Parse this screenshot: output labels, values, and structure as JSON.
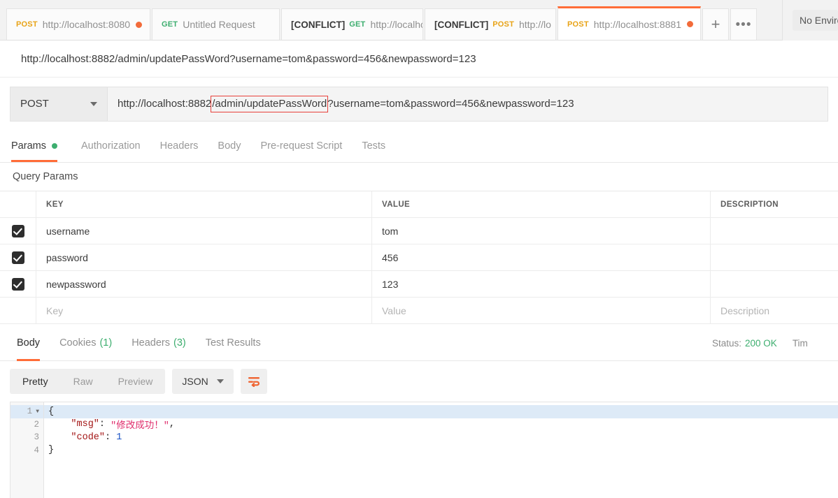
{
  "tabbar": {
    "tabs": [
      {
        "method": "POST",
        "method_color": "#e8a317",
        "label": "http://localhost:8080",
        "conflict": "",
        "unsaved": true,
        "active": false
      },
      {
        "method": "GET",
        "method_color": "#3dae6f",
        "label": "Untitled Request",
        "conflict": "",
        "unsaved": false,
        "active": false
      },
      {
        "method": "GET",
        "method_color": "#3dae6f",
        "label": "http://localho",
        "conflict": "[CONFLICT]",
        "unsaved": false,
        "active": false
      },
      {
        "method": "POST",
        "method_color": "#e8a317",
        "label": "http://lo",
        "conflict": "[CONFLICT]",
        "unsaved": true,
        "active": false
      },
      {
        "method": "POST",
        "method_color": "#e8a317",
        "label": "http://localhost:8881",
        "conflict": "",
        "unsaved": true,
        "active": true
      }
    ],
    "new_tab_label": "+",
    "more_label": "•••",
    "environment_label": "No Environment"
  },
  "request": {
    "title": "http://localhost:8882/admin/updatePassWord?username=tom&password=456&newpassword=123",
    "method": "POST",
    "url_prefix": "http://localhost:8882",
    "url_highlighted": "/admin/updatePassWord",
    "url_suffix": "?username=tom&password=456&newpassword=123",
    "highlight_color": "#e8403a",
    "tabs": [
      {
        "label": "Params",
        "active": true,
        "indicator": true
      },
      {
        "label": "Authorization",
        "active": false,
        "indicator": false
      },
      {
        "label": "Headers",
        "active": false,
        "indicator": false
      },
      {
        "label": "Body",
        "active": false,
        "indicator": false
      },
      {
        "label": "Pre-request Script",
        "active": false,
        "indicator": false
      },
      {
        "label": "Tests",
        "active": false,
        "indicator": false
      }
    ]
  },
  "query_params": {
    "section_title": "Query Params",
    "headers": {
      "key": "KEY",
      "value": "VALUE",
      "description": "DESCRIPTION"
    },
    "rows": [
      {
        "checked": true,
        "key": "username",
        "value": "tom",
        "description": ""
      },
      {
        "checked": true,
        "key": "password",
        "value": "456",
        "description": ""
      },
      {
        "checked": true,
        "key": "newpassword",
        "value": "123",
        "description": ""
      }
    ],
    "placeholder_row": {
      "key": "Key",
      "value": "Value",
      "description": "Description"
    }
  },
  "response": {
    "tabs": [
      {
        "label": "Body",
        "count": "",
        "active": true
      },
      {
        "label": "Cookies",
        "count": "(1)",
        "active": false
      },
      {
        "label": "Headers",
        "count": "(3)",
        "active": false
      },
      {
        "label": "Test Results",
        "count": "",
        "active": false
      }
    ],
    "status_label": "Status:",
    "status_value": "200 OK",
    "status_color": "#3dae6f",
    "time_label": "Tim",
    "view_modes": [
      {
        "label": "Pretty",
        "active": true
      },
      {
        "label": "Raw",
        "active": false
      },
      {
        "label": "Preview",
        "active": false
      }
    ],
    "format": "JSON",
    "wrap_icon": "word-wrap-icon",
    "body_lines": [
      {
        "num": "1",
        "foldable": true,
        "highlighted": true,
        "tokens": [
          {
            "t": "brace",
            "v": "{"
          }
        ]
      },
      {
        "num": "2",
        "foldable": false,
        "highlighted": false,
        "tokens": [
          {
            "t": "key",
            "v": "    \"msg\""
          },
          {
            "t": "colon",
            "v": ": "
          },
          {
            "t": "str",
            "v": "\"修改成功！\""
          },
          {
            "t": "comma",
            "v": ","
          }
        ]
      },
      {
        "num": "3",
        "foldable": false,
        "highlighted": false,
        "tokens": [
          {
            "t": "key",
            "v": "    \"code\""
          },
          {
            "t": "colon",
            "v": ": "
          },
          {
            "t": "num",
            "v": "1"
          }
        ]
      },
      {
        "num": "4",
        "foldable": false,
        "highlighted": false,
        "tokens": [
          {
            "t": "brace",
            "v": "}"
          }
        ]
      }
    ]
  }
}
